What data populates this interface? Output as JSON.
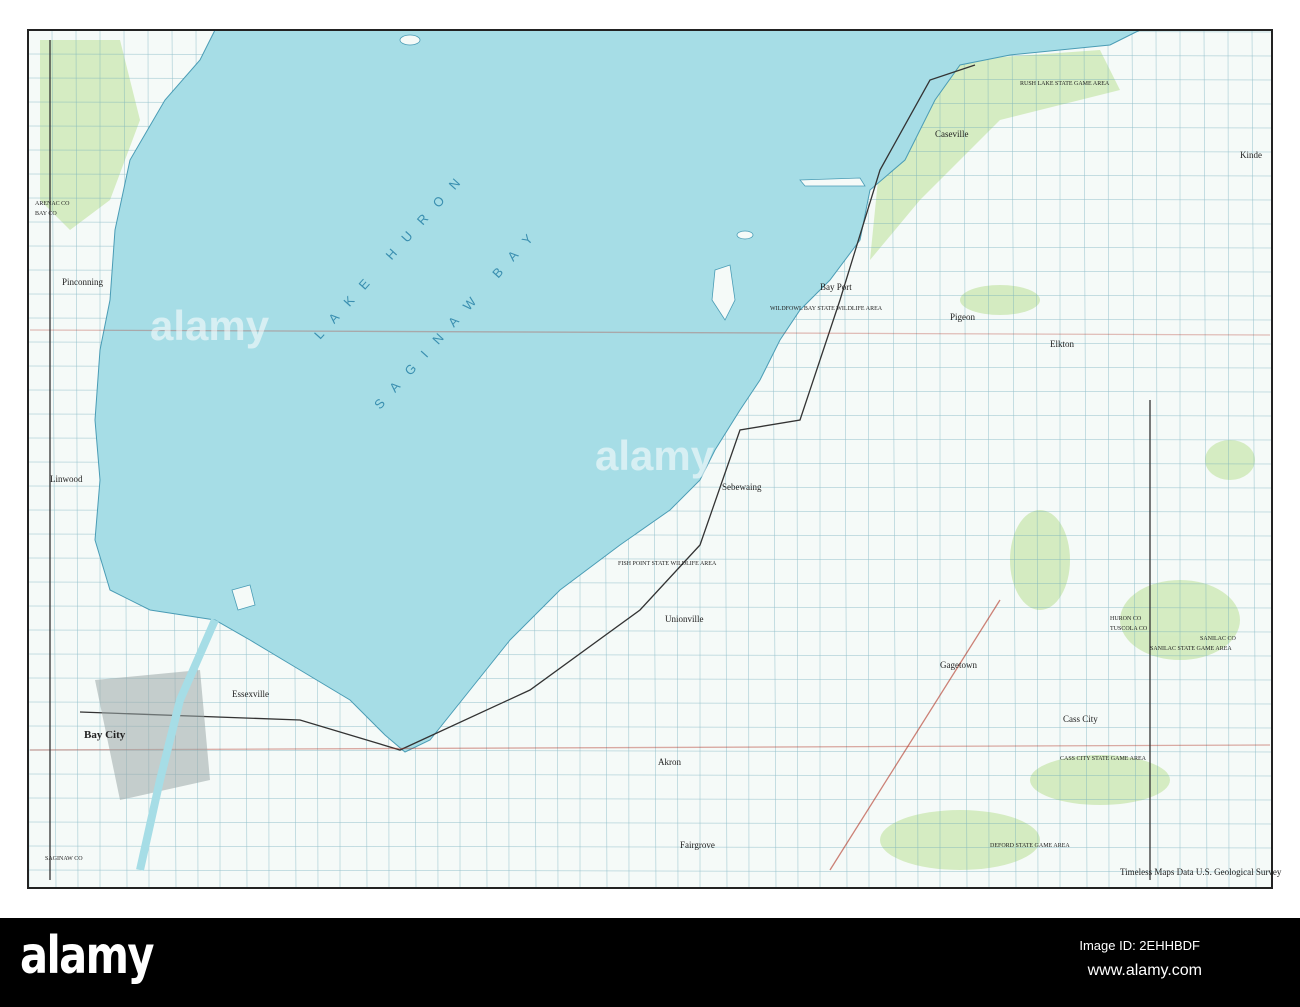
{
  "map": {
    "water_labels": [
      "LAKE HURON",
      "SAGINAW BAY"
    ],
    "places": [
      "Bay City",
      "Essexville",
      "Pinconning",
      "Linwood",
      "Caseville",
      "Bay Port",
      "Pigeon",
      "Sebewaing",
      "Unionville",
      "Cass City",
      "Elkton",
      "Gagetown",
      "Akron",
      "Fairgrove",
      "Kinde"
    ],
    "areas": [
      "WILDFOWL BAY STATE WILDLIFE AREA",
      "FISH POINT STATE WILDLIFE AREA",
      "SANILAC STATE GAME AREA",
      "CASS CITY STATE GAME AREA",
      "DEFORD STATE GAME AREA",
      "RUSH LAKE STATE GAME AREA"
    ],
    "counties": [
      "ARENAC CO",
      "BAY CO",
      "HURON CO",
      "TUSCOLA CO",
      "SAGINAW CO",
      "SANILAC CO"
    ],
    "credit": "Timeless Maps Data U.S. Geological Survey",
    "colors": {
      "water": "#a6dde6",
      "land": "#f7fbf9",
      "forest": "#c8e6b0",
      "road": "#b03020"
    }
  },
  "watermark": "alamy",
  "banner": {
    "logo": "alamy",
    "image_id": "Image ID: 2EHHBDF",
    "site": "www.alamy.com"
  }
}
